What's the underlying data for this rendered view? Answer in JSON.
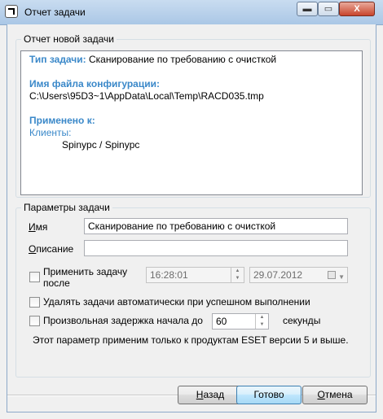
{
  "window": {
    "title": "Отчет задачи",
    "minimize_glyph": "▬",
    "maximize_glyph": "▭",
    "close_glyph": "X"
  },
  "report": {
    "legend": "Отчет новой задачи",
    "task_type_label": "Тип задачи:",
    "task_type_value": "Сканирование по требованию с очисткой",
    "config_label": "Имя файла конфигурации:",
    "config_path": "C:\\Users\\95D3~1\\AppData\\Local\\Temp\\RACD035.tmp",
    "applied_label": "Применено к:",
    "clients_label": "Клиенты:",
    "client_entry": "Spinypc / Spinypc"
  },
  "params": {
    "legend": "Параметры задачи",
    "name_label": "Имя",
    "name_value": "Сканирование по требованию с очисткой",
    "description_label": "Описание",
    "description_value": "",
    "apply_after_label_1": "Применить задачу",
    "apply_after_label_2": "после",
    "apply_after_checked": false,
    "time_value": "16:28:01",
    "date_value": "29.07.2012",
    "delete_auto_label": "Удалять задачи автоматически при успешном выполнении",
    "delete_auto_checked": false,
    "random_delay_label": "Произвольная задержка начала до",
    "random_delay_checked": false,
    "random_delay_value": "60",
    "random_delay_unit": "секунды",
    "note": "Этот параметр применим только к продуктам ESET версии 5 и выше."
  },
  "buttons": {
    "back": "Назад",
    "finish": "Готово",
    "cancel": "Отмена"
  }
}
